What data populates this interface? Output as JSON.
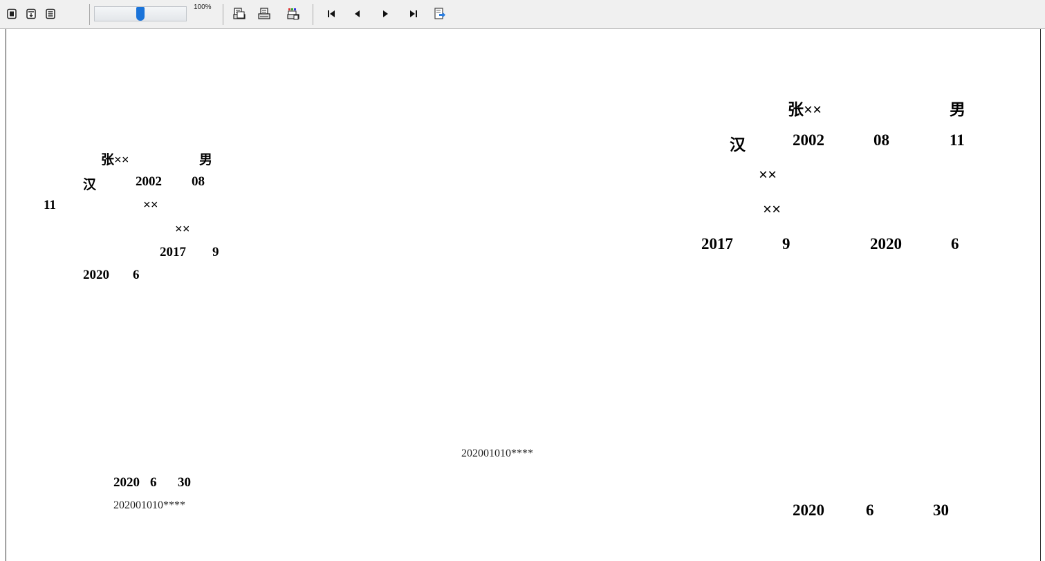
{
  "toolbar": {
    "zoom_percent": "100%",
    "zoom_level": 0.5,
    "buttons": [
      {
        "name": "single-page-view-button",
        "icon": "single-page-icon"
      },
      {
        "name": "page-setup-view-button",
        "icon": "page-width-icon"
      },
      {
        "name": "full-page-view-button",
        "icon": "full-page-icon"
      },
      {
        "name": "print-preview-button",
        "icon": "print-preview-icon"
      },
      {
        "name": "print-button",
        "icon": "printer-icon"
      },
      {
        "name": "print-setup-button",
        "icon": "print-setup-icon"
      },
      {
        "name": "first-page-button",
        "icon": "first-page-icon"
      },
      {
        "name": "prev-page-button",
        "icon": "prev-page-icon"
      },
      {
        "name": "next-page-button",
        "icon": "next-page-icon"
      },
      {
        "name": "last-page-button",
        "icon": "last-page-icon"
      },
      {
        "name": "export-button",
        "icon": "export-icon"
      }
    ]
  },
  "left_form": {
    "name": "张××",
    "gender": "男",
    "ethnicity": "汉",
    "birth_year": "2002",
    "birth_month": "08",
    "birth_day": "11",
    "field_a": "××",
    "field_b": "××",
    "start_year": "2017",
    "start_month": "9",
    "end_year": "2020",
    "end_month": "6",
    "issue_year": "2020",
    "issue_month": "6",
    "issue_day": "30",
    "serial": "202001010****"
  },
  "right_form": {
    "name": "张××",
    "gender": "男",
    "ethnicity": "汉",
    "birth_year": "2002",
    "birth_month": "08",
    "birth_day": "11",
    "field_a": "××",
    "field_b": "××",
    "start_year": "2017",
    "start_month": "9",
    "end_year": "2020",
    "end_month": "6",
    "serial": "202001010****",
    "issue_year": "2020",
    "issue_month": "6",
    "issue_day": "30"
  }
}
